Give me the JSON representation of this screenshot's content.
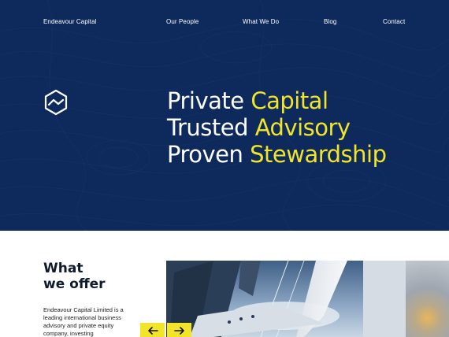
{
  "brand": "Endeavour Capital",
  "nav": [
    "Our People",
    "What We Do",
    "Blog",
    "Contact"
  ],
  "hero": {
    "lines": [
      {
        "white": "Private ",
        "yellow": "Capital"
      },
      {
        "white": "Trusted ",
        "yellow": "Advisory"
      },
      {
        "white": "Proven ",
        "yellow": "Stewardship"
      }
    ]
  },
  "offer": {
    "title_line1": "What",
    "title_line2": "we offer",
    "description": "Endeavour Capital Limited is a leading international business advisory and private equity company, investing"
  },
  "icons": {
    "logo": "hexagon-logo-icon",
    "prev": "arrow-left-icon",
    "next": "arrow-right-icon"
  },
  "colors": {
    "hero_bg": "#0e2a5c",
    "accent": "#f2e528",
    "text_dark": "#0f1a2e"
  }
}
